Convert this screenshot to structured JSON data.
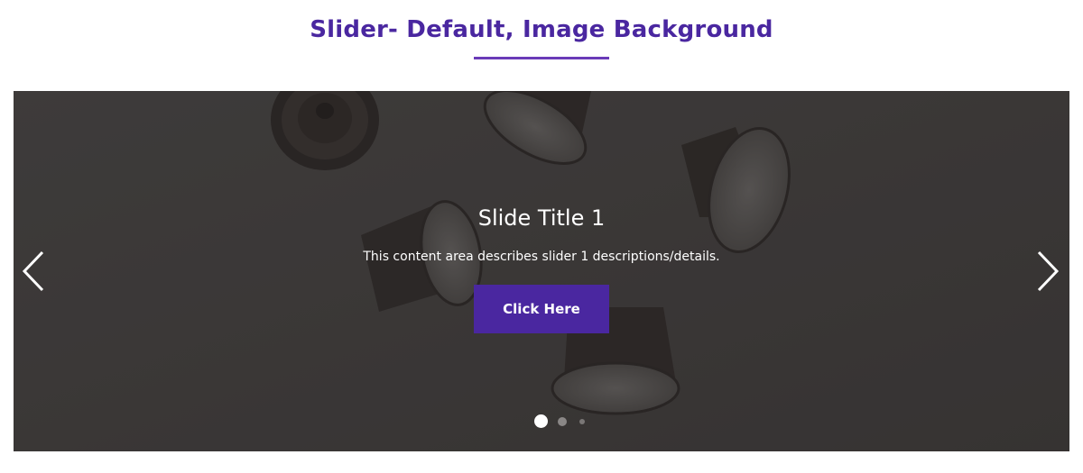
{
  "section": {
    "title": "Slider- Default, Image Background",
    "accent_color": "#4a27a0",
    "underline_color": "#6a3bb8"
  },
  "slider": {
    "current_slide": 1,
    "slide_count": 3,
    "slide": {
      "title": "Slide Title 1",
      "description": "This content area describes slider 1 descriptions/details.",
      "button_label": "Click Here",
      "background": "coffee capsules photo"
    },
    "prev_icon": "chevron-left-icon",
    "next_icon": "chevron-right-icon"
  }
}
